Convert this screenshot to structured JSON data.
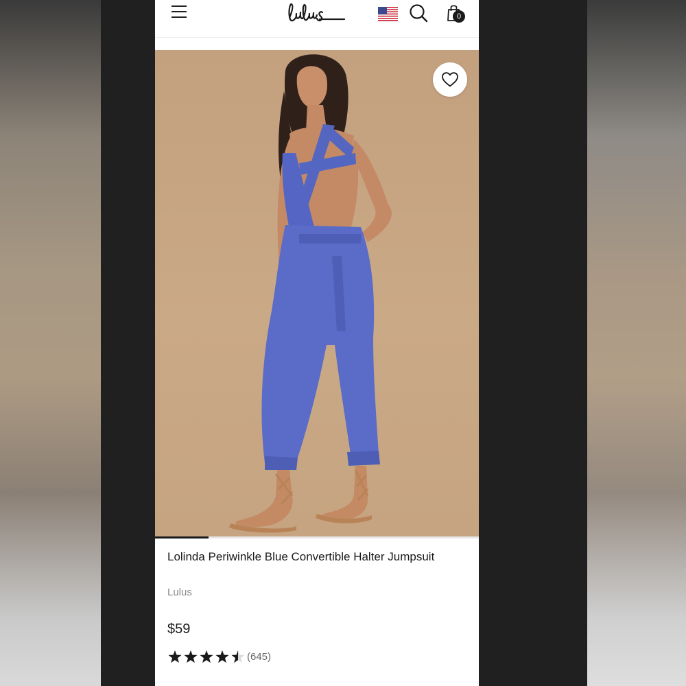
{
  "header": {
    "brand": "Lulus",
    "icons": [
      "menu-icon",
      "us-flag-icon",
      "search-icon",
      "shopping-bag-icon"
    ],
    "cart_count": "0"
  },
  "product": {
    "title": "Lolinda Periwinkle Blue Convertible Halter Jumpsuit",
    "brand": "Lulus",
    "price": "$59",
    "rating": 4.5,
    "rating_max": 5,
    "review_count": "(645)",
    "image_progress": 0.165
  },
  "colors": {
    "image_background": "#c9a885",
    "jumpsuit": "#5b6dc8",
    "ink": "#1a1a1a"
  }
}
